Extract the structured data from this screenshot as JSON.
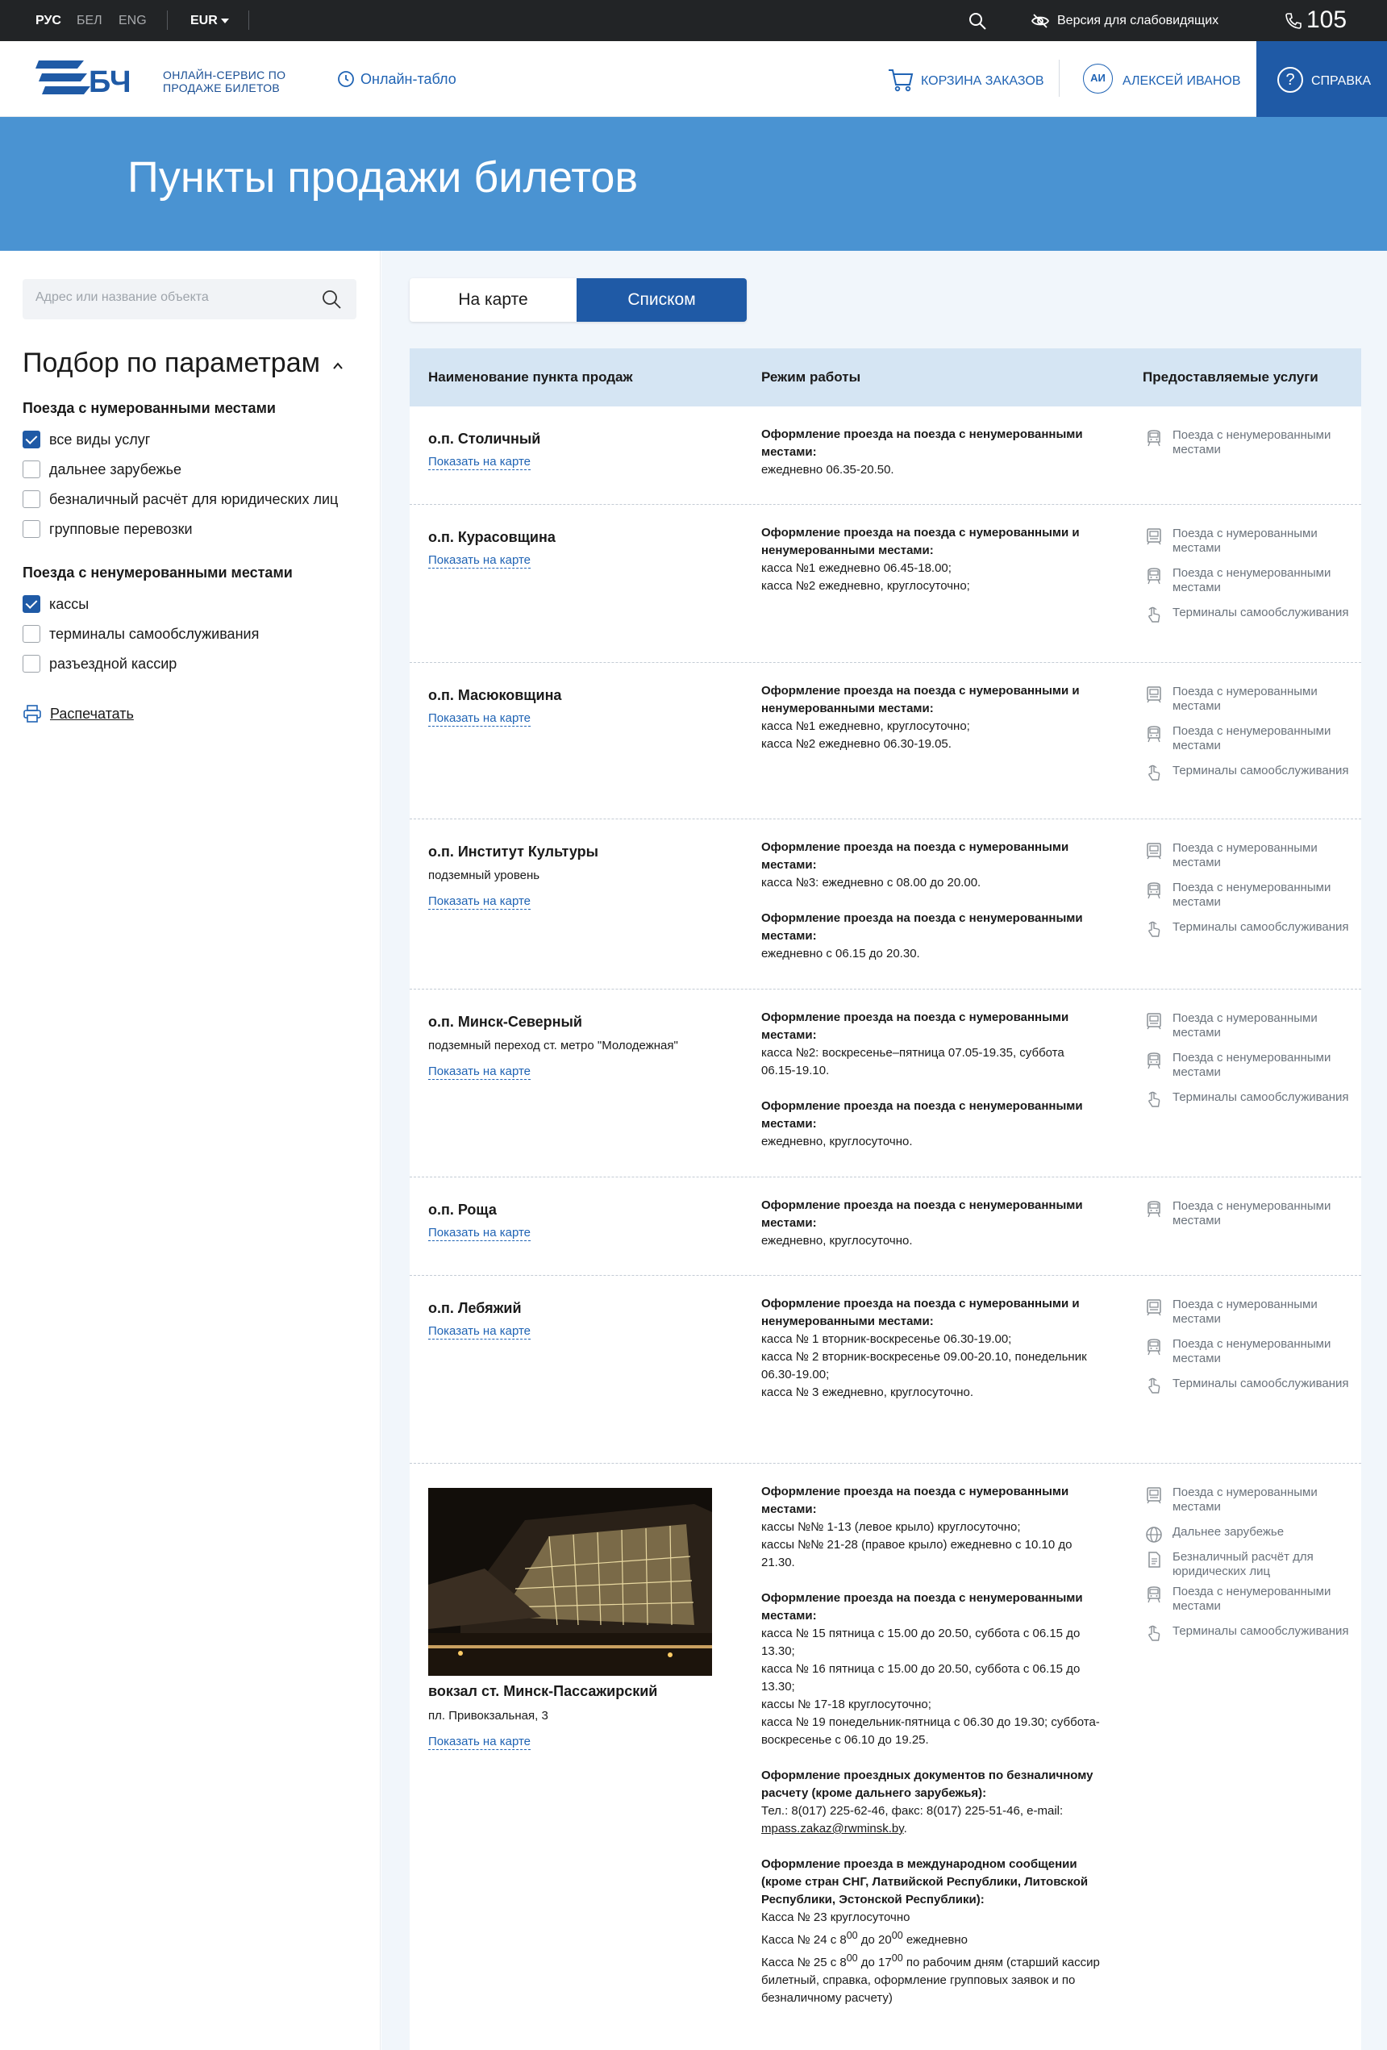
{
  "topbar": {
    "lang_ru": "РУС",
    "lang_by": "БЕЛ",
    "lang_en": "ENG",
    "currency": "EUR",
    "vision": "Версия для слабовидящих",
    "phone": "105",
    "icons": {
      "search": "search-icon",
      "vision": "eye-off-icon",
      "phone": "phone-icon"
    }
  },
  "header": {
    "logo_text": "Онлайн-сервис по продаже билетов",
    "tablo": "Онлайн-табло",
    "cart": "Корзина заказов",
    "avatar": "АИ",
    "user": "Алексей Иванов",
    "help": "Справка",
    "brand_color": "#1f5aa6"
  },
  "page_title": "Пункты продажи билетов",
  "sidebar": {
    "search_placeholder": "Адрес или название объекта",
    "filter_title": "Подбор по параметрам",
    "group1_title": "Поезда с нумерованными местами",
    "group1": [
      {
        "label": "все виды услуг",
        "checked": true
      },
      {
        "label": "дальнее зарубежье",
        "checked": false
      },
      {
        "label": "безналичный расчёт для юридических лиц",
        "checked": false
      },
      {
        "label": "групповые перевозки",
        "checked": false
      }
    ],
    "group2_title": "Поезда с ненумерованными местами",
    "group2": [
      {
        "label": "кассы",
        "checked": true
      },
      {
        "label": "терминалы самообслуживания",
        "checked": false
      },
      {
        "label": "разъездной кассир",
        "checked": false
      }
    ],
    "print": "Распечатать"
  },
  "view_toggle": {
    "map": "На карте",
    "list": "Списком"
  },
  "table": {
    "col_name": "Наименование пункта продаж",
    "col_schedule": "Режим работы",
    "col_services": "Предоставляемые услуги",
    "show_map": "Показать на карте",
    "svc_numbered": "Поезда с нумерованными местами",
    "svc_unnumbered": "Поезда с ненумерованными местами",
    "svc_terminals": "Терминалы самообслуживания",
    "svc_abroad": "Дальнее зарубежье",
    "svc_cashless": "Безналичный расчёт для юридических лиц",
    "rows": [
      {
        "name": "о.п. Столичный",
        "sched_title": "Оформление проезда на поезда с ненумерованными местами:",
        "sched_lines": [
          "ежедневно 06.35-20.50."
        ]
      },
      {
        "name": "о.п. Курасовщина",
        "sched_title": "Оформление проезда на поезда с нумерованными и ненумерованными местами:",
        "sched_lines": [
          "касса №1 ежедневно 06.45-18.00;",
          "касса №2 ежедневно, круглосуточно;"
        ]
      },
      {
        "name": "о.п. Масюковщина",
        "sched_title": "Оформление проезда на поезда с нумерованными и ненумерованными местами:",
        "sched_lines": [
          "касса №1 ежедневно, круглосуточно;",
          "касса №2 ежедневно 06.30-19.05."
        ]
      },
      {
        "name": "о.п. Институт Культуры",
        "addr": "подземный уровень",
        "sched_title": "Оформление проезда на поезда с нумерованными местами:",
        "sched_lines": [
          "касса №3: ежедневно с 08.00 до 20.00."
        ],
        "sched_title2": "Оформление проезда на поезда с ненумерованными местами:",
        "sched_lines2": [
          "ежедневно с 06.15 до 20.30."
        ]
      },
      {
        "name": "о.п. Минск-Северный",
        "addr": "подземный переход ст. метро \"Молодежная\"",
        "sched_title": "Оформление проезда на поезда с нумерованными местами:",
        "sched_lines": [
          "касса №2: воскресенье–пятница 07.05-19.35, суббота 06.15-19.10."
        ],
        "sched_title2": "Оформление проезда на поезда с ненумерованными местами:",
        "sched_lines2": [
          "ежедневно, круглосуточно."
        ]
      },
      {
        "name": "о.п. Роща",
        "sched_title": "Оформление проезда на поезда с ненумерованными местами:",
        "sched_lines": [
          "ежедневно, круглосуточно."
        ]
      },
      {
        "name": "о.п. Лебяжий",
        "sched_title": "Оформление проезда на поезда с нумерованными  и ненумерованными местами:",
        "sched_lines": [
          "касса № 1 вторник-воскресенье 06.30-19.00;",
          "касса № 2  вторник-воскресенье 09.00-20.10, понедельник 06.30-19.00;",
          "касса № 3 ежедневно, круглосуточно."
        ]
      },
      {
        "name": "вокзал ст. Минск-Пассажирский",
        "addr": "пл. Привокзальная, 3",
        "s1_title": "Оформление проезда на поезда с нумерованными местами:",
        "s1_lines": [
          "кассы №№ 1-13 (левое крыло) круглосуточно;",
          "кассы №№ 21-28 (правое крыло) ежедневно с 10.10 до 21.30."
        ],
        "s2_title": "Оформление проезда на поезда с ненумерованными местами:",
        "s2_lines": [
          "касса № 15 пятница с 15.00 до 20.50, суббота с 06.15 до 13.30;",
          "касса № 16 пятница с 15.00 до 20.50, суббота с 06.15 до 13.30;",
          "кассы № 17-18 круглосуточно;",
          "касса № 19 понедельник-пятница с 06.30 до 19.30; суббота-воскресенье с 06.10 до 19.25."
        ],
        "s3_title": "Оформление проездных документов по безналичному расчету (кроме дальнего зарубежья):",
        "s3_line": "Тел.: 8(017) 225-62-46, факс: 8(017) 225-51-46, e-mail:",
        "s3_mail": "mpass.zakaz@rwminsk.by",
        "s4_title": "Оформление проезда в международном сообщении (кроме стран СНГ, Латвийской Республики, Литовской Республики, Эстонской Республики):",
        "s4_l1": "Касса № 23 круглосуточно",
        "s4_l2a": "Касса № 24 с 8",
        "s4_l2b": "00",
        "s4_l2c": " до 20",
        "s4_l2d": "00",
        "s4_l2e": " ежедневно",
        "s4_l3a": "Касса № 25 с 8",
        "s4_l3b": "00",
        "s4_l3c": " до 17",
        "s4_l3d": "00",
        "s4_l3e": " по рабочим дням (старший кассир билетный, справка, оформление групповых заявок и по безналичному расчету)"
      }
    ]
  }
}
